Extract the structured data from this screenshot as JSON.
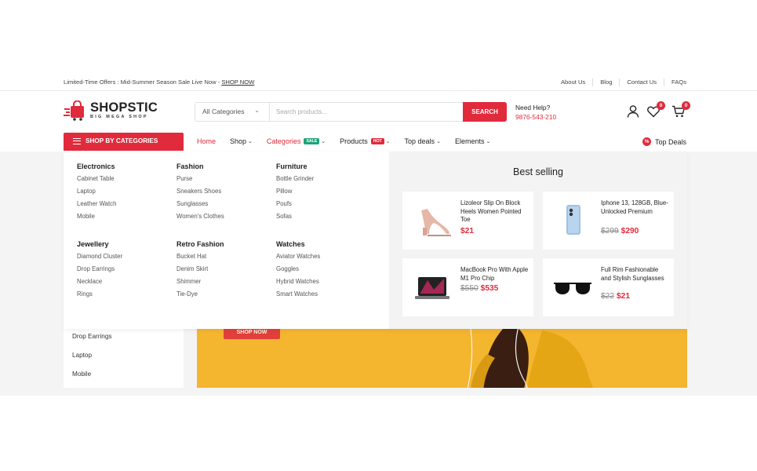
{
  "topbar": {
    "offer_text": "Limited-Time Offers : Mid-Summer Season Sale Live Now - ",
    "offer_link": "SHOP NOW",
    "links": [
      "About Us",
      "Blog",
      "Contact Us",
      "FAQs"
    ]
  },
  "logo": {
    "name": "SHOPSTIC",
    "tagline": "BIG MEGA SHOP"
  },
  "search": {
    "category": "All Categories",
    "placeholder": "Search products...",
    "button": "SEARCH"
  },
  "help": {
    "label": "Need Help?",
    "phone": "9876-543-210"
  },
  "header_icons": {
    "user_icon": "user-icon",
    "wishlist_icon": "heart-icon",
    "wishlist_count": "0",
    "cart_icon": "cart-icon",
    "cart_count": "0"
  },
  "nav": {
    "shop_by": "SHOP BY CATEGORIES",
    "items": [
      {
        "label": "Home"
      },
      {
        "label": "Shop"
      },
      {
        "label": "Categories",
        "tag": "SALE"
      },
      {
        "label": "Products",
        "tag": "HOT"
      },
      {
        "label": "Top deals"
      },
      {
        "label": "Elements"
      }
    ],
    "top_deals": "Top Deals"
  },
  "mega": {
    "columns": [
      {
        "title": "Electronics",
        "items": [
          "Cabinet Table",
          "Laptop",
          "Leather Watch",
          "Mobile"
        ]
      },
      {
        "title": "Fashion",
        "items": [
          "Purse",
          "Sneakers Shoes",
          "Sunglasses",
          "Women's Clothes"
        ]
      },
      {
        "title": "Furniture",
        "items": [
          "Bottle Grinder",
          "Pillow",
          "Poufs",
          "Sofas"
        ]
      },
      {
        "title": "Jewellery",
        "items": [
          "Diamond Cluster",
          "Drop Earrings",
          "Necklace",
          "Rings"
        ]
      },
      {
        "title": "Retro Fashion",
        "items": [
          "Bucket Hat",
          "Denim Skirt",
          "Shimmer",
          "Tie-Dye"
        ]
      },
      {
        "title": "Watches",
        "items": [
          "Aviator Watches",
          "Goggles",
          "Hybrid Watches",
          "Smart Watches"
        ]
      }
    ],
    "best_selling": {
      "title": "Best selling",
      "products": [
        {
          "name": "Lizoleor Slip On Block Heels Women Pointed Toe",
          "old_price": "",
          "price": "$21",
          "icon": "heels-icon"
        },
        {
          "name": "Iphone 13, 128GB, Blue- Unlocked Premium",
          "old_price": "$299",
          "price": "$290",
          "icon": "phone-icon"
        },
        {
          "name": "MacBook Pro With Apple M1 Pro Chip",
          "old_price": "$550",
          "price": "$535",
          "icon": "laptop-icon"
        },
        {
          "name": "Full Rim Fashionable and Stylish Sunglasses",
          "old_price": "$22",
          "price": "$21",
          "icon": "sunglasses-icon"
        }
      ]
    }
  },
  "sidebar_list": [
    "Drop Earrings",
    "Laptop",
    "Mobile"
  ],
  "banner": {
    "button": "SHOP NOW"
  },
  "colors": {
    "accent": "#e12b3c",
    "sale": "#1ea37b",
    "banner": "#f4b52f"
  }
}
